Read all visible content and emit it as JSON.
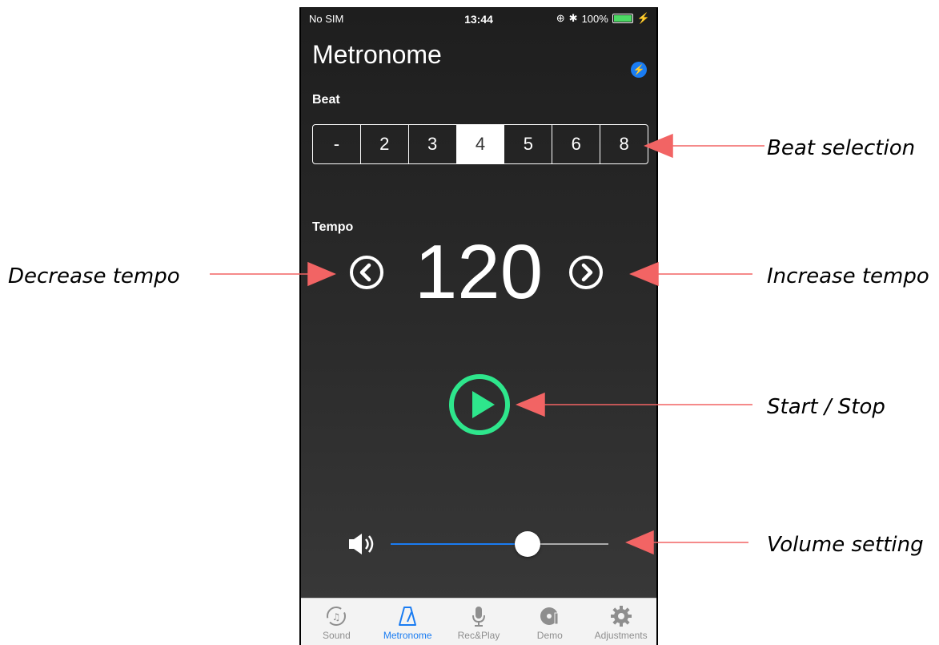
{
  "status": {
    "carrier": "No SIM",
    "time": "13:44",
    "battery": "100%"
  },
  "header": {
    "title": "Metronome",
    "bluetooth_icon": "bluetooth-icon"
  },
  "beat": {
    "label": "Beat",
    "options": [
      "-",
      "2",
      "3",
      "4",
      "5",
      "6",
      "8"
    ],
    "selected": "4"
  },
  "tempo": {
    "label": "Tempo",
    "value": "120"
  },
  "volume": {
    "level": 0.63
  },
  "tabs": [
    {
      "label": "Sound",
      "icon": "sound-icon"
    },
    {
      "label": "Metronome",
      "icon": "metronome-icon",
      "active": true
    },
    {
      "label": "Rec&Play",
      "icon": "microphone-icon"
    },
    {
      "label": "Demo",
      "icon": "disc-icon"
    },
    {
      "label": "Adjustments",
      "icon": "gear-icon"
    }
  ],
  "annotations": {
    "beat_selection": "Beat selection",
    "decrease_tempo": "Decrease tempo",
    "increase_tempo": "Increase tempo",
    "start_stop": "Start / Stop",
    "volume_setting": "Volume setting"
  },
  "colors": {
    "accent": "#1a7cf2",
    "play": "#2ee68c",
    "annotation_arrow": "#f26464"
  }
}
